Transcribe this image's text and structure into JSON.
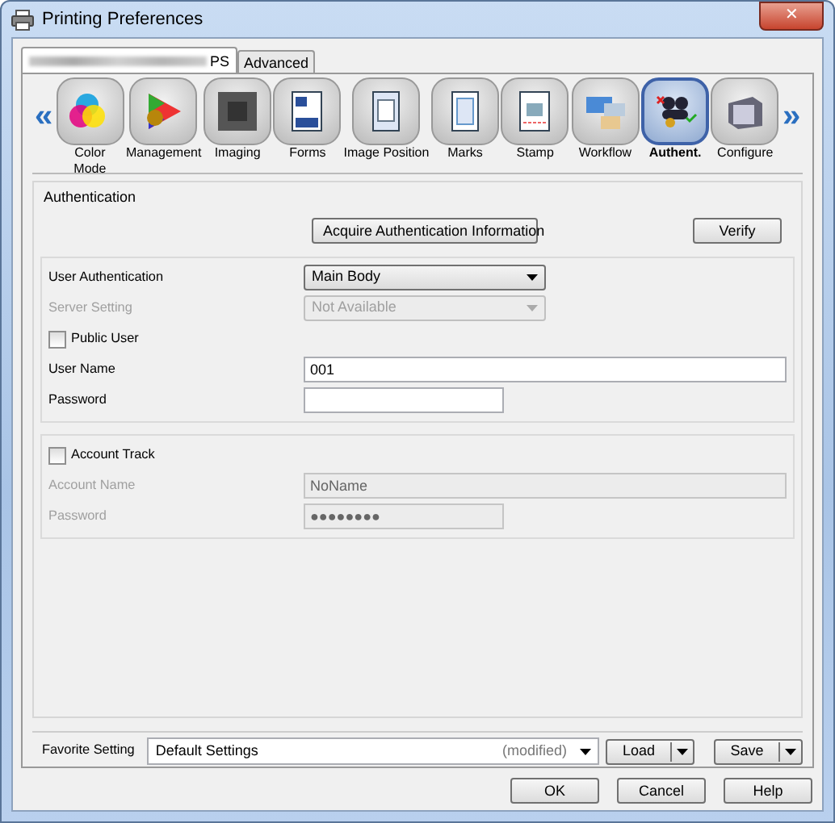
{
  "window": {
    "title": "Printing Preferences",
    "close": "✕"
  },
  "tabs": [
    {
      "label": "PS",
      "selected": true,
      "redacted": true
    },
    {
      "label": "Advanced",
      "selected": false
    }
  ],
  "toolbar": {
    "prev": "«",
    "next": "»",
    "items": [
      {
        "label": "Color Mode",
        "selected": false
      },
      {
        "label": "Management",
        "selected": false
      },
      {
        "label": "Imaging",
        "selected": false
      },
      {
        "label": "Forms",
        "selected": false
      },
      {
        "label": "Image Position",
        "selected": false
      },
      {
        "label": "Marks",
        "selected": false
      },
      {
        "label": "Stamp",
        "selected": false
      },
      {
        "label": "Workflow",
        "selected": false
      },
      {
        "label": "Authent.",
        "selected": true
      },
      {
        "label": "Configure",
        "selected": false
      }
    ]
  },
  "section": {
    "title": "Authentication",
    "buttons": [
      {
        "label": "Acquire Authentication Information"
      },
      {
        "label": "Verify"
      }
    ],
    "groups": [
      {
        "rows": [
          {
            "kind": "select",
            "label": "User Authentication",
            "value": "Main Body",
            "disabled": false
          },
          {
            "kind": "select",
            "label": "Server Setting",
            "value": "Not Available",
            "disabled": true
          },
          {
            "kind": "checkbox",
            "label": "Public User",
            "checked": false,
            "disabled": false
          },
          {
            "kind": "input",
            "label": "User Name",
            "value": "001",
            "disabled": false,
            "wide": true
          },
          {
            "kind": "input",
            "label": "Password",
            "value": "",
            "disabled": false,
            "wide": false
          }
        ]
      },
      {
        "rows": [
          {
            "kind": "checkbox",
            "label": "Account Track",
            "checked": false,
            "disabled": false
          },
          {
            "kind": "input",
            "label": "Account Name",
            "value": "NoName",
            "disabled": true,
            "wide": true
          },
          {
            "kind": "input",
            "label": "Password",
            "value": "●●●●●●●●",
            "disabled": true,
            "wide": false
          }
        ]
      }
    ]
  },
  "favorite": {
    "label": "Favorite Setting",
    "value": "Default Settings",
    "note": "(modified)",
    "buttons": [
      "Load",
      "Save"
    ]
  },
  "dialog_buttons": [
    "OK",
    "Cancel",
    "Help"
  ]
}
